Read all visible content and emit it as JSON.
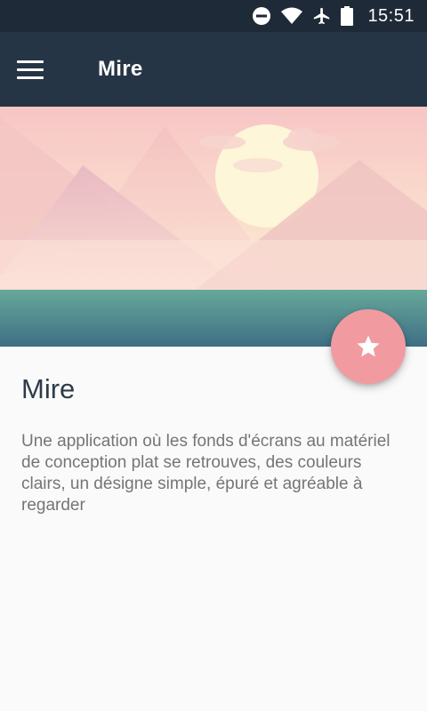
{
  "status_bar": {
    "time": "15:51",
    "icons": [
      "do-not-disturb-icon",
      "wifi-icon",
      "airplane-mode-icon",
      "battery-icon"
    ]
  },
  "app_bar": {
    "title": "Mire",
    "menu_icon": "hamburger-menu-icon"
  },
  "hero": {
    "illustration": "pastel mountains with sun, clouds and lake"
  },
  "fab": {
    "icon": "star-icon",
    "color": "#f19ba0"
  },
  "content": {
    "title": "Mire",
    "description": "Une application où les fonds d'écrans au matériel de conception plat se retrouves, des couleurs clairs, un désigne simple, épuré et agréable à regarder"
  },
  "colors": {
    "status_bar": "#1e2a37",
    "app_bar": "#263545",
    "accent": "#f19ba0",
    "background": "#fafafa"
  }
}
